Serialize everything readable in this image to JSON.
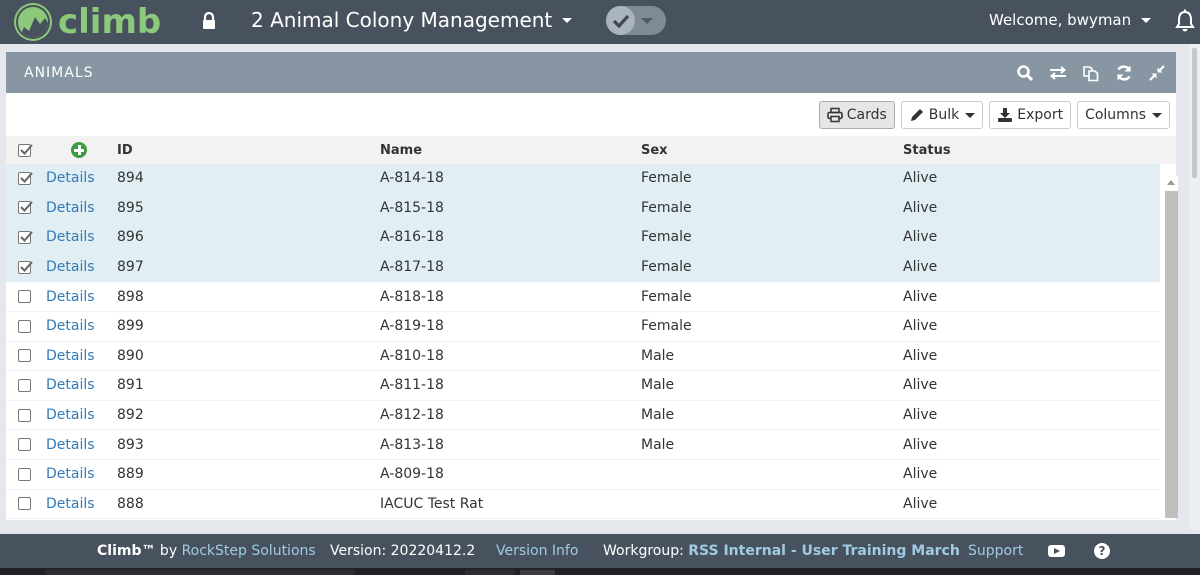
{
  "topbar": {
    "logo_text": "climb",
    "app_title": "2 Animal Colony Management",
    "welcome": "Welcome, bwyman"
  },
  "panel": {
    "title": "ANIMALS",
    "tools": [
      "search-icon",
      "swap-icon",
      "copy-icon",
      "refresh-icon",
      "collapse-icon"
    ]
  },
  "toolbar": {
    "cards_label": "Cards",
    "bulk_label": "Bulk",
    "export_label": "Export",
    "columns_label": "Columns"
  },
  "grid": {
    "columns": [
      "ID",
      "Name",
      "Sex",
      "Status"
    ],
    "details_label": "Details",
    "rows": [
      {
        "selected": true,
        "id": "894",
        "name": "A-814-18",
        "sex": "Female",
        "status": "Alive"
      },
      {
        "selected": true,
        "id": "895",
        "name": "A-815-18",
        "sex": "Female",
        "status": "Alive"
      },
      {
        "selected": true,
        "id": "896",
        "name": "A-816-18",
        "sex": "Female",
        "status": "Alive"
      },
      {
        "selected": true,
        "id": "897",
        "name": "A-817-18",
        "sex": "Female",
        "status": "Alive"
      },
      {
        "selected": false,
        "id": "898",
        "name": "A-818-18",
        "sex": "Female",
        "status": "Alive"
      },
      {
        "selected": false,
        "id": "899",
        "name": "A-819-18",
        "sex": "Female",
        "status": "Alive"
      },
      {
        "selected": false,
        "id": "890",
        "name": "A-810-18",
        "sex": "Male",
        "status": "Alive"
      },
      {
        "selected": false,
        "id": "891",
        "name": "A-811-18",
        "sex": "Male",
        "status": "Alive"
      },
      {
        "selected": false,
        "id": "892",
        "name": "A-812-18",
        "sex": "Male",
        "status": "Alive"
      },
      {
        "selected": false,
        "id": "893",
        "name": "A-813-18",
        "sex": "Male",
        "status": "Alive"
      },
      {
        "selected": false,
        "id": "889",
        "name": "A-809-18",
        "sex": "",
        "status": "Alive"
      },
      {
        "selected": false,
        "id": "888",
        "name": "IACUC Test Rat",
        "sex": "",
        "status": "Alive"
      }
    ]
  },
  "footer": {
    "brand": "Climb™",
    "by": " by ",
    "company": "RockStep Solutions",
    "version": "Version: 20220412.2",
    "version_info": "Version Info",
    "workgroup_label": "Workgroup: ",
    "workgroup": "RSS Internal - User Training March",
    "support": "Support",
    "help": "?"
  },
  "colors": {
    "nav_bg": "#48525e",
    "brand_green": "#8cc97a",
    "panel_header": "#8796a2",
    "selected_row": "#e1eff4",
    "link": "#337ab7",
    "add_green": "#3f9b3f"
  }
}
